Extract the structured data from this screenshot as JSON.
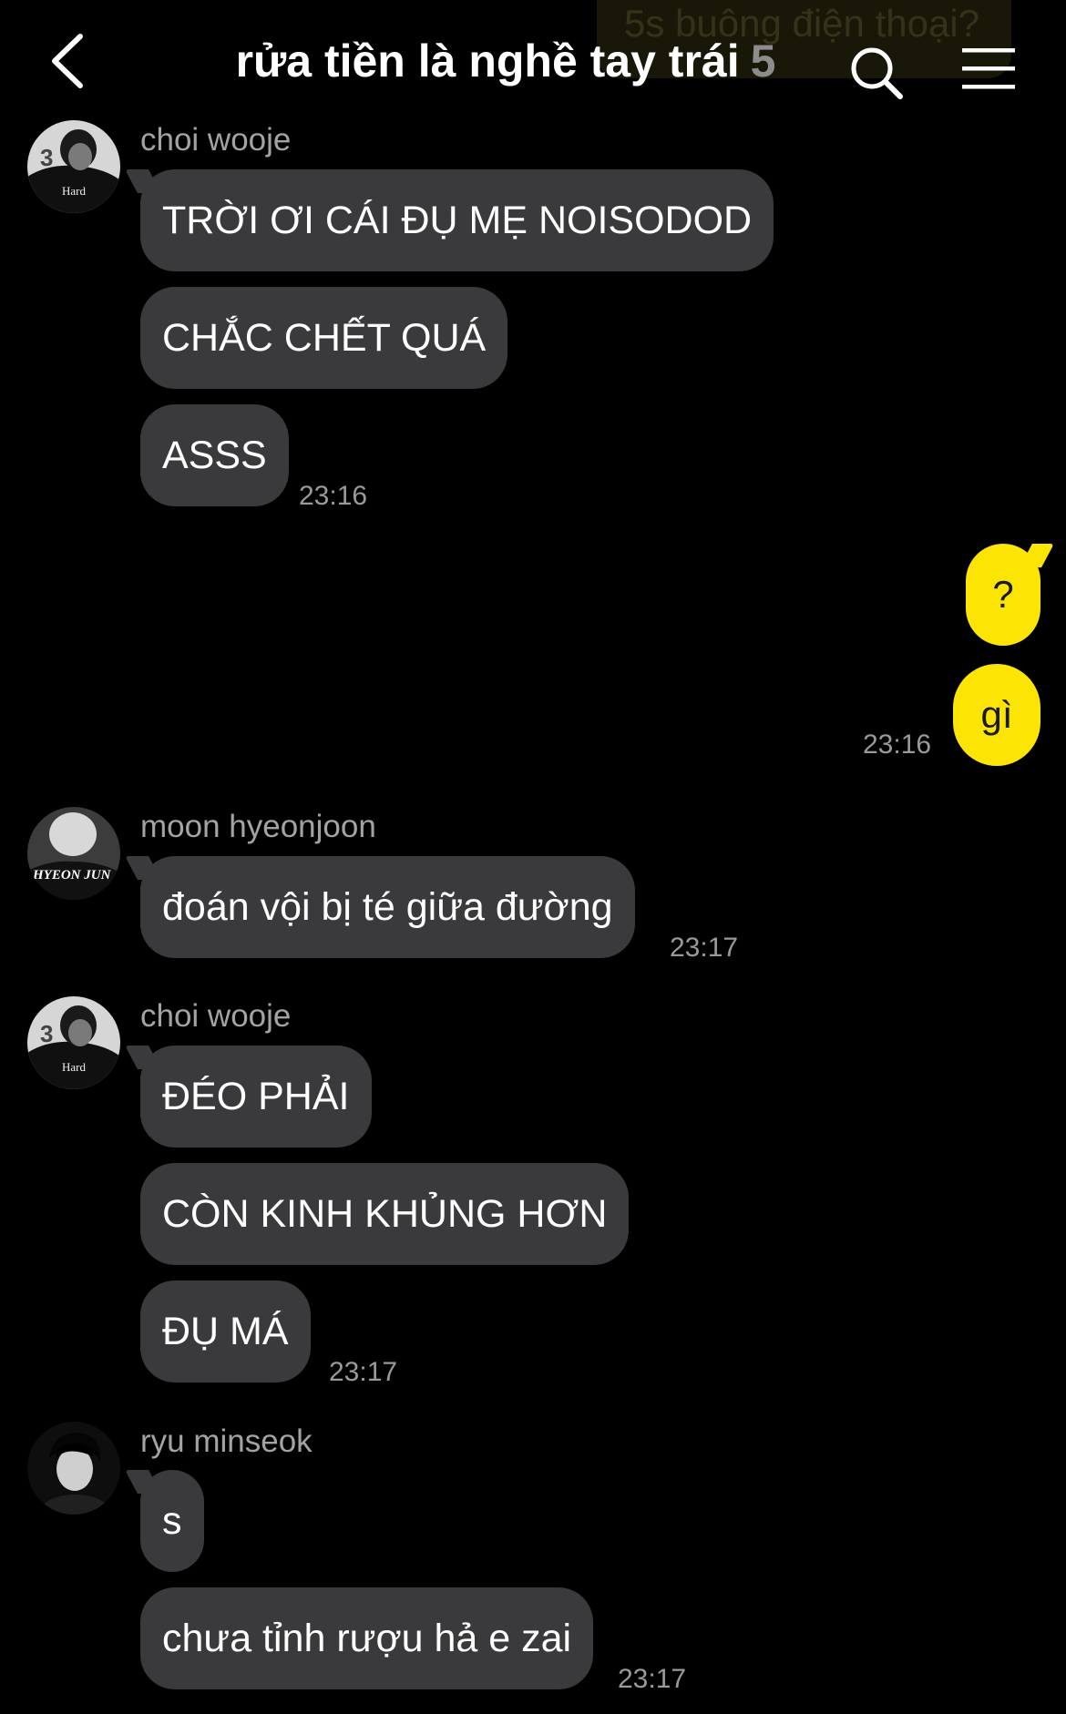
{
  "ghost_banner": "5s buông điện thoại?",
  "header": {
    "back_icon": "chevron-left-icon",
    "title": "rửa tiền là nghề tay trái",
    "member_count": "5",
    "search_icon": "search-icon",
    "menu_icon": "hamburger-menu-icon"
  },
  "colors": {
    "background": "#000000",
    "incoming_bubble": "#3a3a3c",
    "outgoing_bubble": "#fce404",
    "timestamp": "#9a9a9a"
  },
  "groups": [
    {
      "sender": "choi wooje",
      "messages": [
        "TRỜI ƠI CÁI ĐỤ MẸ NOISODOD",
        "CHẮC CHẾT QUÁ",
        "ASSS"
      ],
      "time": "23:16"
    },
    {
      "sender": "me",
      "messages": [
        "?",
        "gì"
      ],
      "time": "23:16"
    },
    {
      "sender": "moon hyeonjoon",
      "avatar_text": "HYEON JUN",
      "messages": [
        "đoán vội bị té giữa đường"
      ],
      "time": "23:17"
    },
    {
      "sender": "choi wooje",
      "messages": [
        "ĐÉO PHẢI",
        "CÒN KINH KHỦNG HƠN",
        "ĐỤ MÁ"
      ],
      "time": "23:17"
    },
    {
      "sender": "ryu minseok",
      "messages": [
        "s",
        "chưa tỉnh rượu hả e zai"
      ],
      "time": "23:17"
    }
  ]
}
